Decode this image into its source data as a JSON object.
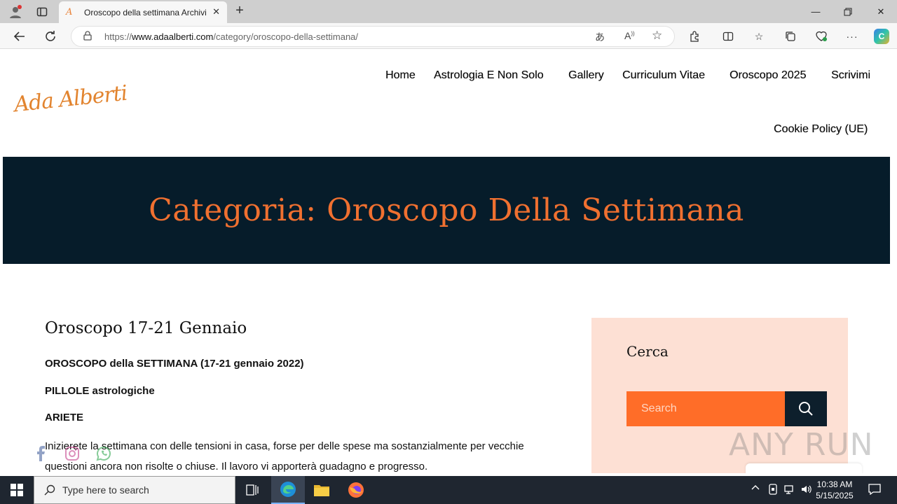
{
  "browser": {
    "tab_title": "Oroscopo della settimana Archivi",
    "tab_favicon": "A",
    "url_prefix": "https://",
    "url_domain": "www.adaalberti.com",
    "url_path": "/category/oroscopo-della-settimana/"
  },
  "site": {
    "logo_text": "Ada Alberti",
    "accent_color": "#f07030",
    "menu": [
      {
        "label": "Home"
      },
      {
        "label": "Astrologia E Non Solo"
      },
      {
        "label": "Gallery"
      },
      {
        "label": "Curriculum Vitae"
      },
      {
        "label": "Oroscopo 2025"
      },
      {
        "label": "Scrivimi"
      },
      {
        "label": "Cookie Policy (UE)"
      }
    ],
    "hero_title": "Categoria: Oroscopo Della Settimana"
  },
  "post": {
    "title": "Oroscopo 17-21 Gennaio",
    "subtitle": "OROSCOPO della SETTIMANA (17-21 gennaio 2022)",
    "section": "PILLOLE astrologiche",
    "sign": "ARIETE",
    "body": "Inizierete la settimana con delle tensioni in casa, forse per delle spese ma sostanzialmente per vecchie questioni ancora non risolte o chiuse. Il lavoro vi apporterà guadagno e progresso."
  },
  "sidebar": {
    "widget_title": "Cerca",
    "search_placeholder": "Search"
  },
  "watermark": "ANY RUN",
  "taskbar": {
    "search_placeholder": "Type here to search",
    "time": "10:38 AM",
    "date": "5/15/2025"
  }
}
